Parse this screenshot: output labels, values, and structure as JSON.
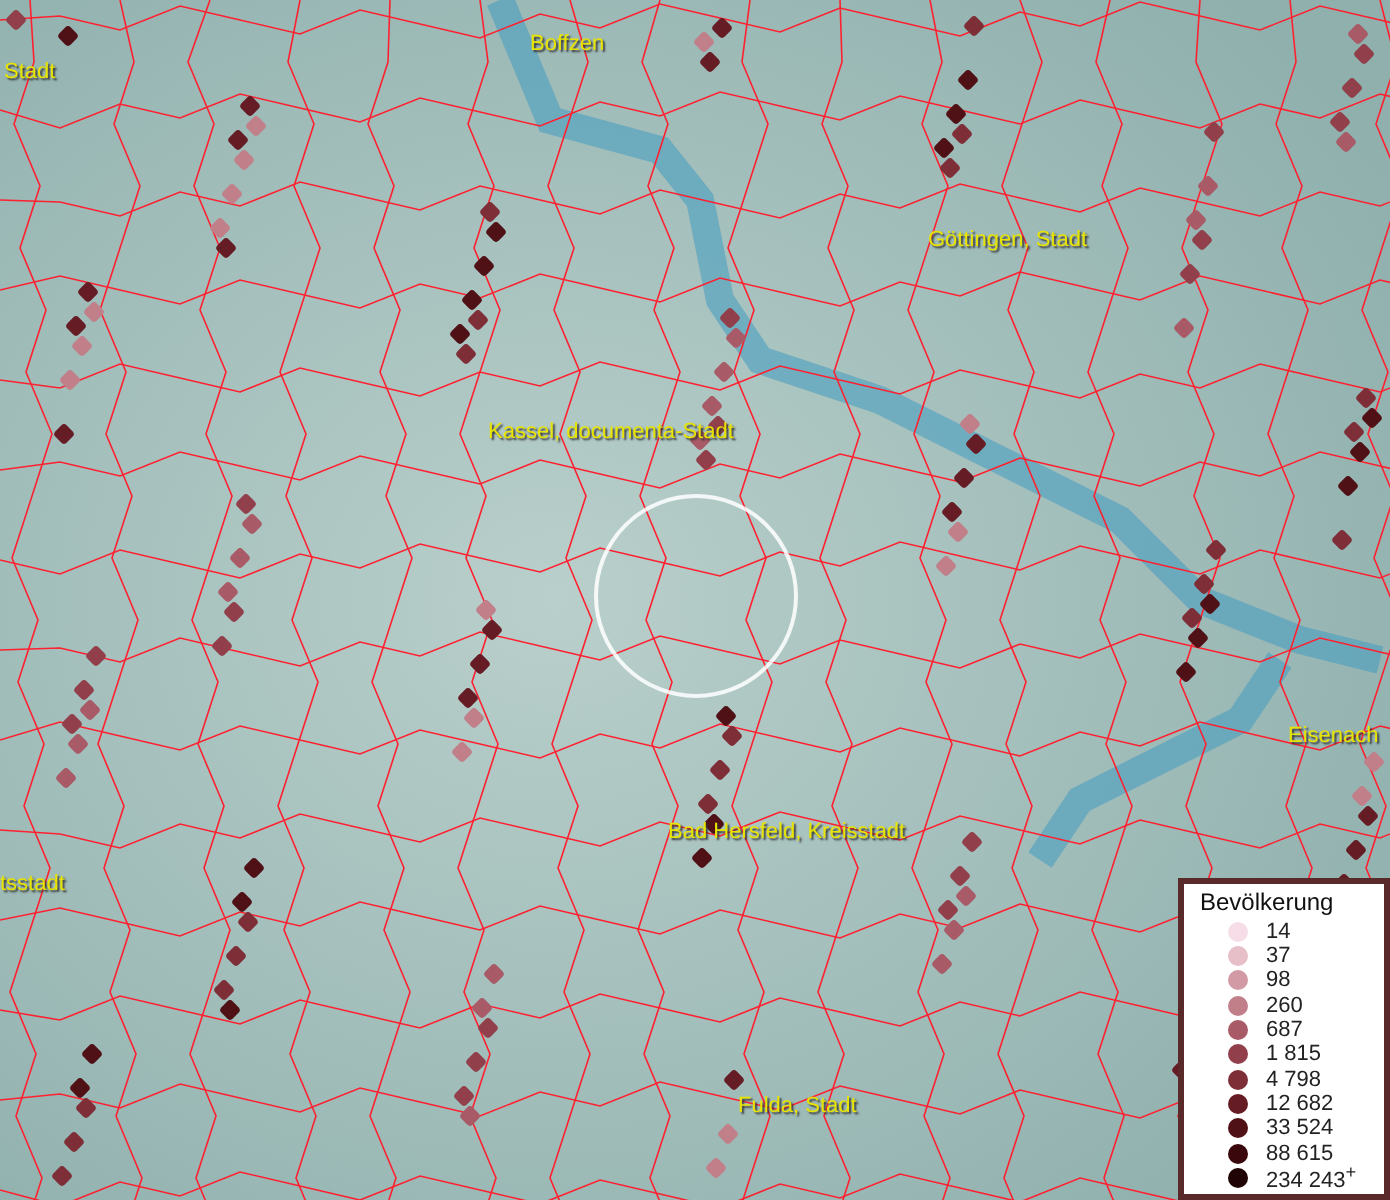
{
  "map": {
    "place_labels": [
      {
        "text": "Boffzen"
      },
      {
        "text": "Stadt"
      },
      {
        "text": "Göttingen, Stadt"
      },
      {
        "text": "Kassel, documenta-Stadt"
      },
      {
        "text": "Eisenach"
      },
      {
        "text": "Bad Hersfeld, Kreisstadt"
      },
      {
        "text": "tsstadt"
      },
      {
        "text": "Fulda, Stadt"
      }
    ]
  },
  "legend": {
    "title": "Bevölkerung",
    "items": [
      {
        "label": "14",
        "color": "#f6dde8"
      },
      {
        "label": "37",
        "color": "#e6bfc8"
      },
      {
        "label": "98",
        "color": "#d29aa5"
      },
      {
        "label": "260",
        "color": "#c07f89"
      },
      {
        "label": "687",
        "color": "#a85b66"
      },
      {
        "label": "1 815",
        "color": "#91404b"
      },
      {
        "label": "4 798",
        "color": "#7d2e37"
      },
      {
        "label": "12 682",
        "color": "#651c24"
      },
      {
        "label": "33 524",
        "color": "#4f1016"
      },
      {
        "label": "88 615",
        "color": "#3a080c"
      },
      {
        "label": "234 243$^{+}$",
        "color": "#200304"
      }
    ]
  }
}
